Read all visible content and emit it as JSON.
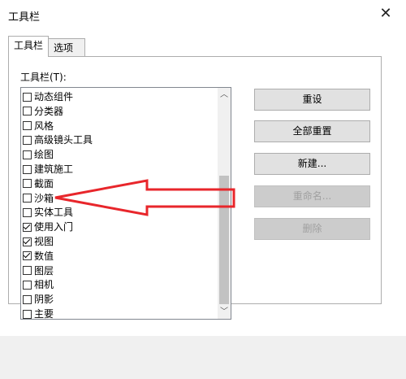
{
  "window": {
    "title": "工具栏"
  },
  "tabs": [
    {
      "label": "工具栏",
      "active": true
    },
    {
      "label": "选项",
      "active": false
    }
  ],
  "toolbar_list": {
    "label": "工具栏(T):",
    "items": [
      {
        "label": "动态组件",
        "checked": false
      },
      {
        "label": "分类器",
        "checked": false
      },
      {
        "label": "风格",
        "checked": false
      },
      {
        "label": "高级镜头工具",
        "checked": false
      },
      {
        "label": "绘图",
        "checked": false
      },
      {
        "label": "建筑施工",
        "checked": false
      },
      {
        "label": "截面",
        "checked": false
      },
      {
        "label": "沙箱",
        "checked": false
      },
      {
        "label": "实体工具",
        "checked": false
      },
      {
        "label": "使用入门",
        "checked": true
      },
      {
        "label": "视图",
        "checked": true
      },
      {
        "label": "数值",
        "checked": true
      },
      {
        "label": "图层",
        "checked": false
      },
      {
        "label": "相机",
        "checked": false
      },
      {
        "label": "阴影",
        "checked": false
      },
      {
        "label": "主要",
        "checked": false
      }
    ]
  },
  "buttons": {
    "reset": "重设",
    "reset_all": "全部重置",
    "new": "新建...",
    "rename": "重命名...",
    "delete": "删除"
  },
  "annotation": {
    "color": "#e8262b"
  }
}
